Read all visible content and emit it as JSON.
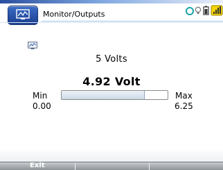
{
  "titlebar": {
    "title": "Monitor/Outputs",
    "app_icon": "monitor-graph-icon",
    "accent_color": "#2a4ea0"
  },
  "status_icons": [
    "connection-ring-icon",
    "lightbulb-icon",
    "battery-icon",
    "signal-icon"
  ],
  "content": {
    "small_icon": "monitor-graph-icon",
    "setpoint": "5 Volts",
    "reading": "4.92 Volt",
    "min_label": "Min",
    "min_value": "0.00",
    "max_label": "Max",
    "max_value": "6.25",
    "fill_fraction": 0.787
  },
  "softkeys": {
    "exit_label": "Exit"
  }
}
